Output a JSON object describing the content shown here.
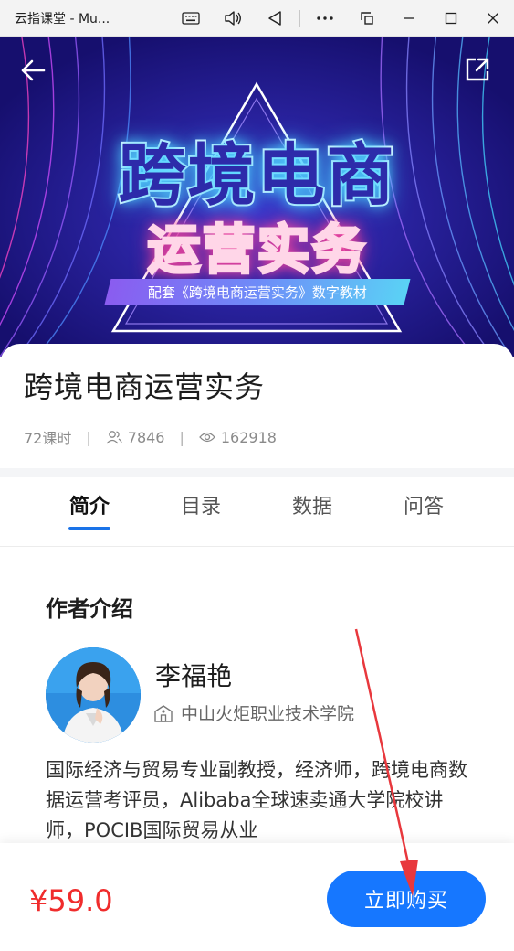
{
  "window": {
    "title": "云指课堂 - Mu..."
  },
  "banner": {
    "headline": "跨境电商",
    "subline": "运营实务",
    "ribbon": "配套《跨境电商运营实务》数字教材"
  },
  "course": {
    "title": "跨境电商运营实务",
    "lessons": "72课时",
    "learners": "7846",
    "views": "162918"
  },
  "tabs": [
    {
      "label": "简介",
      "active": true
    },
    {
      "label": "目录",
      "active": false
    },
    {
      "label": "数据",
      "active": false
    },
    {
      "label": "问答",
      "active": false
    }
  ],
  "author": {
    "section_title": "作者介绍",
    "name": "李福艳",
    "school": "中山火炬职业技术学院",
    "bio": "国际经济与贸易专业副教授，经济师，跨境电商数据运营考评员，Alibaba全球速卖通大学院校讲师，POCIB国际贸易从业"
  },
  "purchase": {
    "price": "¥59.0",
    "buy_label": "立即购买"
  },
  "colors": {
    "accent": "#1677ff",
    "price": "#f02c2c",
    "banner_bg": "#1a1780",
    "annotation_arrow": "#e8383d"
  },
  "icons": [
    "back-arrow-icon",
    "share-icon",
    "keyboard-icon",
    "volume-icon",
    "back-triangle-icon",
    "more-icon",
    "snap-icon",
    "minimize-icon",
    "maximize-icon",
    "close-icon",
    "learners-icon",
    "views-icon",
    "school-icon"
  ]
}
